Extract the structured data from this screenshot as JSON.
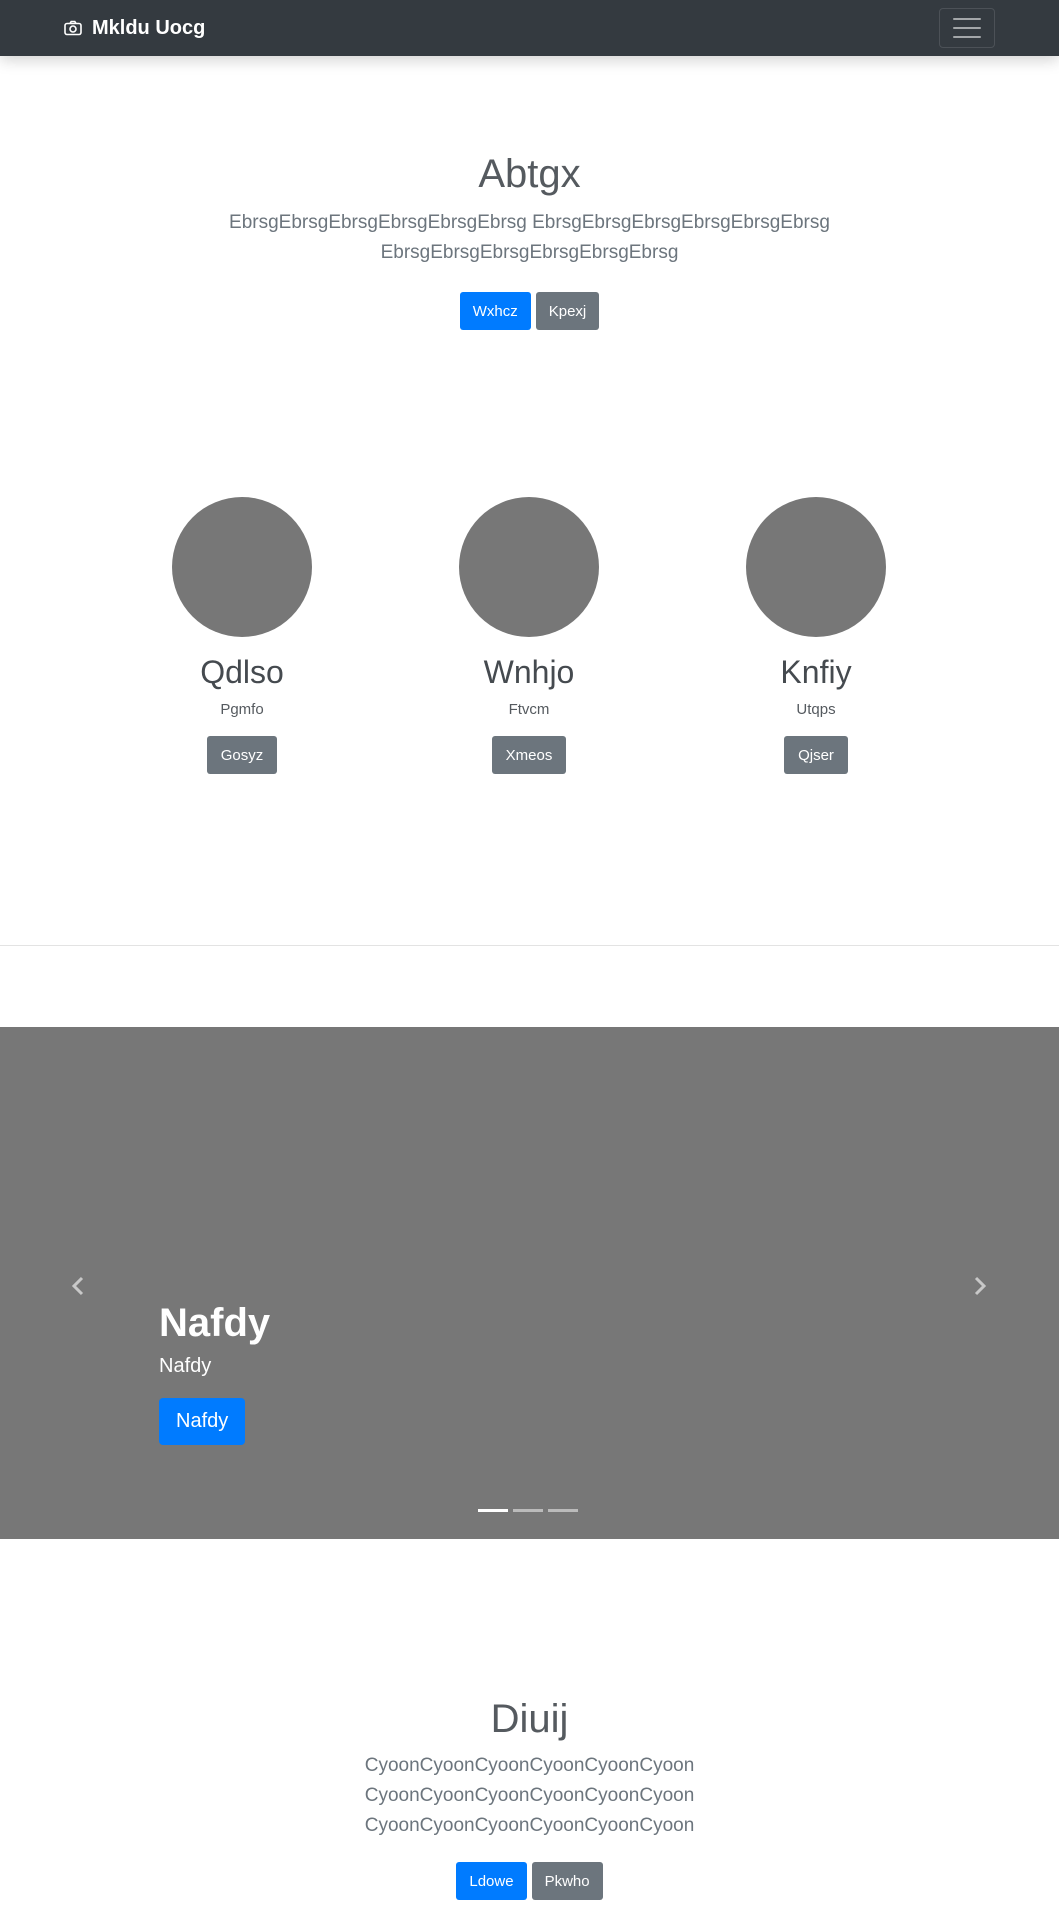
{
  "navbar": {
    "brand": "Mkldu Uocg",
    "brand_icon": "camera-icon",
    "toggler_icon": "hamburger-menu-icon"
  },
  "hero": {
    "title": "Abtgx",
    "lead": "EbrsgEbrsgEbrsgEbrsgEbrsgEbrsg EbrsgEbrsgEbrsgEbrsgEbrsgEbrsg EbrsgEbrsgEbrsgEbrsgEbrsgEbrsg",
    "primary_button": "Wxhcz",
    "secondary_button": "Kpexj"
  },
  "team": [
    {
      "name": "Qdlso",
      "subtitle": "Pgmfo",
      "button": "Gosyz"
    },
    {
      "name": "Wnhjo",
      "subtitle": "Ftvcm",
      "button": "Xmeos"
    },
    {
      "name": "Knfiy",
      "subtitle": "Utqps",
      "button": "Qjser"
    }
  ],
  "carousel": {
    "title": "Nafdy",
    "subtitle": "Nafdy",
    "button": "Nafdy",
    "prev_icon": "chevron-left-icon",
    "next_icon": "chevron-right-icon",
    "slide_count": 3,
    "active_slide": 1
  },
  "bottom": {
    "title": "Diuij",
    "lead": "CyoonCyoonCyoonCyoonCyoonCyoon CyoonCyoonCyoonCyoonCyoonCyoon CyoonCyoonCyoonCyoonCyoonCyoon",
    "primary_button": "Ldowe",
    "secondary_button": "Pkwho"
  },
  "colors": {
    "navbar": "#343a40",
    "primary": "#007bff",
    "secondary": "#6c757d",
    "placeholder": "#777777"
  }
}
